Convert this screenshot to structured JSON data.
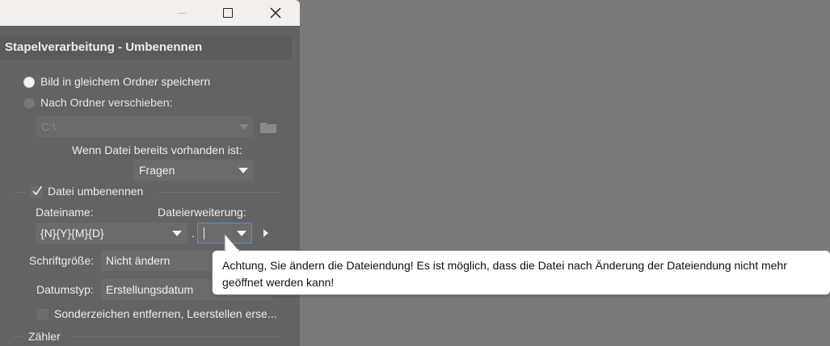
{
  "window": {
    "minimize_icon": "minimize-icon",
    "maximize_icon": "maximize-icon",
    "close_icon": "close-icon"
  },
  "dialog": {
    "title": "Stapelverarbeitung - Umbenennen",
    "save": {
      "same_folder_label": "Bild in gleichem Ordner speichern",
      "move_folder_label": "Nach Ordner verschieben:",
      "folder_path": "C:\\",
      "folder_icon": "folder-icon",
      "exists_label": "Wenn Datei bereits vorhanden ist:",
      "exists_value": "Fragen"
    },
    "rename": {
      "section_label": "Datei umbenennen",
      "filename_label": "Dateiname:",
      "filename_value": "{N}{Y}{M}{D}",
      "extension_label": "Dateierweiterung:",
      "dot": ".",
      "extension_value": "",
      "fontsize_label": "Schriftgröße:",
      "fontsize_value": "Nicht ändern",
      "datetype_label": "Datumstyp:",
      "datetype_value": "Erstellungsdatum",
      "special_chars_label": "Sonderzeichen entfernen, Leerstellen erse..."
    },
    "counter_label": "Zähler"
  },
  "tooltip": {
    "text": "Achtung, Sie ändern die Dateiendung! Es ist möglich, dass die Datei nach Änderung der Dateiendung nicht mehr geöffnet werden kann!"
  },
  "colors": {
    "dialog_bg": "#636363",
    "backdrop": "#7a7a7a",
    "focus_border": "#5b8fd1"
  }
}
